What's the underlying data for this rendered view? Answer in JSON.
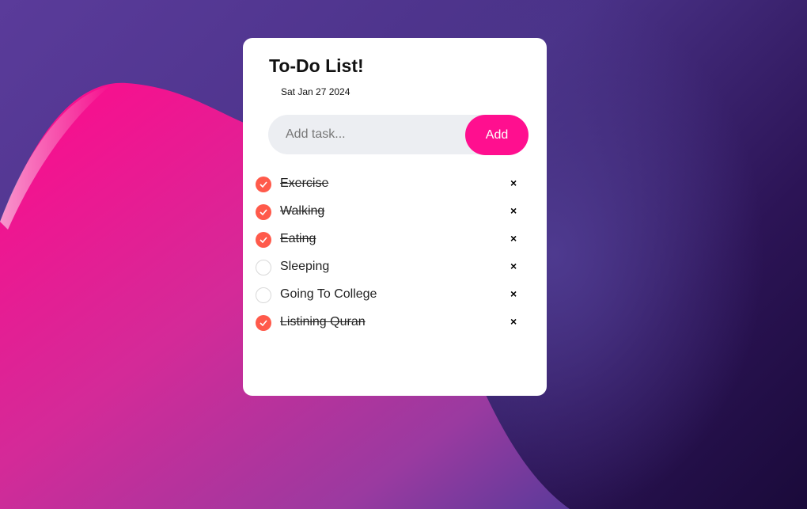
{
  "app": {
    "title": "To-Do List!",
    "date": "Sat Jan 27 2024"
  },
  "input": {
    "placeholder": "Add task...",
    "value": "",
    "add_label": "Add"
  },
  "remove_glyph": "×",
  "colors": {
    "accent": "#ff0f8f",
    "checked": "#ff5a4b",
    "input_bg": "#eceef2"
  },
  "tasks": [
    {
      "label": "Exercise",
      "done": true
    },
    {
      "label": "Walking",
      "done": true
    },
    {
      "label": "Eating",
      "done": true
    },
    {
      "label": "Sleeping",
      "done": false
    },
    {
      "label": "Going To College",
      "done": false
    },
    {
      "label": "Listining Quran",
      "done": true
    }
  ]
}
